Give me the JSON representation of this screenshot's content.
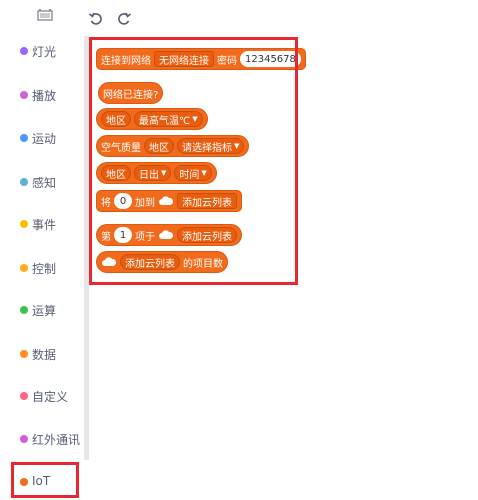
{
  "toolbar": {
    "device_icon": "device-icon",
    "undo_icon": "undo-icon",
    "redo_icon": "redo-icon"
  },
  "sidebar": {
    "items": [
      {
        "label": "灯光",
        "color": "#9966ff"
      },
      {
        "label": "播放",
        "color": "#cf63cf"
      },
      {
        "label": "运动",
        "color": "#4c97ff"
      },
      {
        "label": "感知",
        "color": "#5cb1d6"
      },
      {
        "label": "事件",
        "color": "#ffbf00"
      },
      {
        "label": "控制",
        "color": "#ffab19"
      },
      {
        "label": "运算",
        "color": "#40bf4a"
      },
      {
        "label": "数据",
        "color": "#ff8c1a"
      },
      {
        "label": "自定义",
        "color": "#ff6680"
      },
      {
        "label": "红外通讯",
        "color": "#d65cd6"
      },
      {
        "label": "IoT",
        "color": "#f26a1b"
      }
    ],
    "selected": "IoT"
  },
  "blocks": {
    "connect_wifi": {
      "label": "连接到网络",
      "network": "无网络连接",
      "password_label": "密码",
      "password_value": "12345678"
    },
    "network_connected": {
      "label": "网络已连接?"
    },
    "max_temp": {
      "region": "地区",
      "metric": "最高气温℃"
    },
    "air_quality": {
      "label": "空气质量",
      "region": "地区",
      "index": "请选择指标"
    },
    "sun": {
      "region": "地区",
      "event": "日出",
      "time": "时间"
    },
    "add_cloud": {
      "prefix": "将",
      "value": "0",
      "mid": "加到",
      "list": "添加云列表"
    },
    "item_of": {
      "prefix": "第",
      "value": "1",
      "mid": "项于",
      "list": "添加云列表"
    },
    "length_of": {
      "list": "添加云列表",
      "suffix": "的项目数"
    }
  },
  "colors": {
    "block": "#f26a1b",
    "highlight": "#e8272e"
  }
}
